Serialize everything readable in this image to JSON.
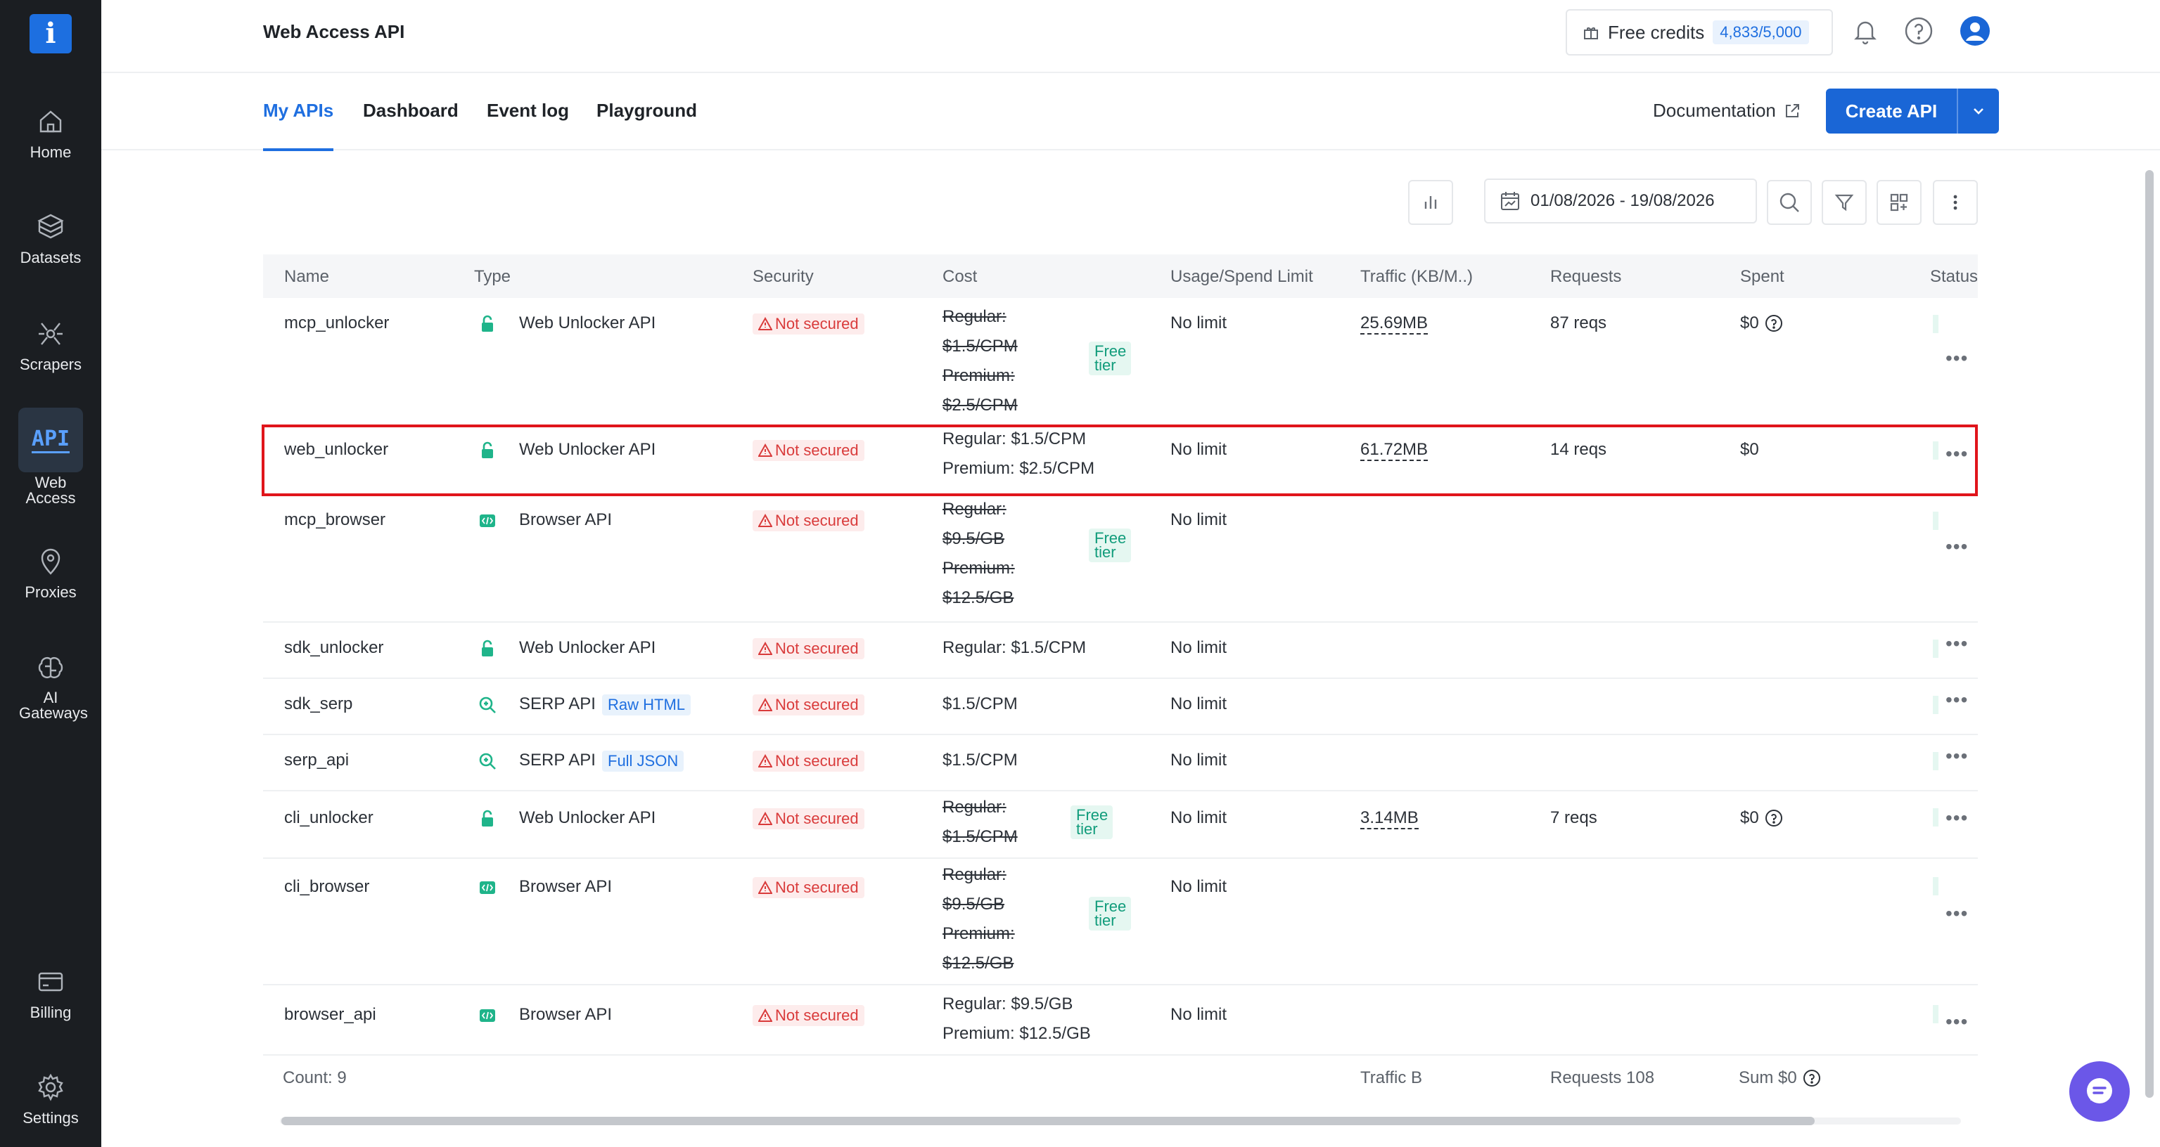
{
  "app": {
    "logo_glyph": "i",
    "page_title": "Web Access API"
  },
  "sidebar": {
    "items": [
      {
        "label": "Home",
        "icon": "home-icon"
      },
      {
        "label": "Datasets",
        "icon": "layers-icon"
      },
      {
        "label": "Scrapers",
        "icon": "scraper-icon"
      },
      {
        "label": "Web Access",
        "icon": "api-icon",
        "active": true
      },
      {
        "label": "Proxies",
        "icon": "map-pin-icon"
      },
      {
        "label": "AI Gateways",
        "icon": "brain-icon"
      },
      {
        "label": "Billing",
        "icon": "card-icon"
      },
      {
        "label": "Settings",
        "icon": "gear-icon"
      }
    ],
    "api_badge_text": "API"
  },
  "header": {
    "credits_label": "Free credits",
    "credits_value": "4,833/5,000"
  },
  "tabs": [
    {
      "label": "My APIs",
      "active": true
    },
    {
      "label": "Dashboard"
    },
    {
      "label": "Event log"
    },
    {
      "label": "Playground"
    }
  ],
  "actions": {
    "documentation": "Documentation",
    "create_api": "Create API"
  },
  "toolbar": {
    "date_range": "01/08/2026 - 19/08/2026"
  },
  "table": {
    "columns": [
      "Name",
      "Type",
      "Security",
      "Cost",
      "Usage/Spend Limit",
      "Traffic (KB/M..)",
      "Requests",
      "Spent",
      "Status"
    ],
    "rows": [
      {
        "name": "mcp_unlocker",
        "type": "Web Unlocker API",
        "security": "Not secured",
        "cost_lines": [
          "Regular:",
          "$1.5/CPM",
          "Premium:",
          "$2.5/CPM"
        ],
        "free_tier": "Free tier",
        "limit": "No limit",
        "traffic": "25.69MB",
        "requests": "87 reqs",
        "spent": "$0"
      },
      {
        "name": "web_unlocker",
        "type": "Web Unlocker API",
        "security": "Not secured",
        "cost_lines": [
          "Regular: $1.5/CPM",
          "Premium: $2.5/CPM"
        ],
        "limit": "No limit",
        "traffic": "61.72MB",
        "requests": "14 reqs",
        "spent": "$0"
      },
      {
        "name": "mcp_browser",
        "type": "Browser API",
        "security": "Not secured",
        "cost_lines": [
          "Regular:",
          "$9.5/GB",
          "Premium:",
          "$12.5/GB"
        ],
        "free_tier": "Free tier",
        "limit": "No limit"
      },
      {
        "name": "sdk_unlocker",
        "type": "Web Unlocker API",
        "security": "Not secured",
        "cost_lines": [
          "Regular: $1.5/CPM"
        ],
        "limit": "No limit"
      },
      {
        "name": "sdk_serp",
        "type": "SERP API",
        "type_tag": "Raw HTML",
        "security": "Not secured",
        "cost_lines": [
          "$1.5/CPM"
        ],
        "limit": "No limit"
      },
      {
        "name": "serp_api",
        "type": "SERP API",
        "type_tag": "Full JSON",
        "security": "Not secured",
        "cost_lines": [
          "$1.5/CPM"
        ],
        "limit": "No limit"
      },
      {
        "name": "cli_unlocker",
        "type": "Web Unlocker API",
        "security": "Not secured",
        "cost_lines": [
          "Regular:",
          "$1.5/CPM"
        ],
        "free_tier": "Free tier",
        "limit": "No limit",
        "traffic": "3.14MB",
        "requests": "7 reqs",
        "spent": "$0"
      },
      {
        "name": "cli_browser",
        "type": "Browser API",
        "security": "Not secured",
        "cost_lines": [
          "Regular:",
          "$9.5/GB",
          "Premium:",
          "$12.5/GB"
        ],
        "free_tier": "Free tier",
        "limit": "No limit"
      },
      {
        "name": "browser_api",
        "type": "Browser API",
        "security": "Not secured",
        "cost_lines": [
          "Regular: $9.5/GB",
          "Premium: $12.5/GB"
        ],
        "limit": "No limit"
      }
    ],
    "footer": {
      "count": "Count: 9",
      "traffic": "Traffic B",
      "requests": "Requests 108",
      "sum": "Sum $0"
    },
    "more_glyph": "•••"
  },
  "colors": {
    "accent": "#1a66d6",
    "danger": "#d93b3b",
    "free_tier": "#119c7b",
    "highlight": "#e0151b"
  }
}
